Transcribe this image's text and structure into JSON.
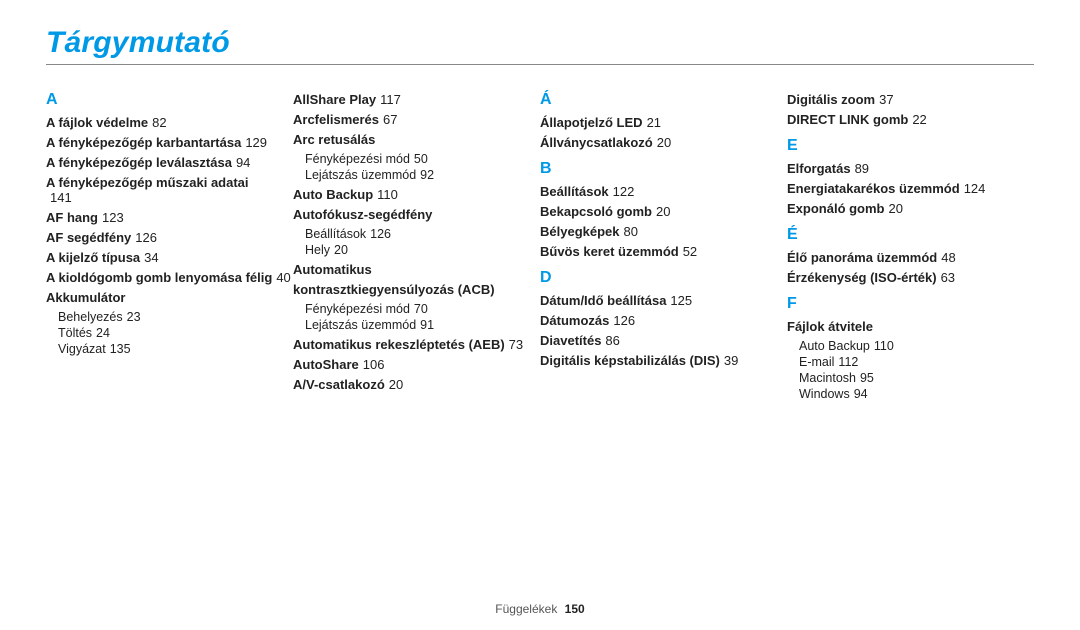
{
  "title": "Tárgymutató",
  "footer": {
    "label": "Függelékek",
    "page": "150"
  },
  "col1": {
    "letter1": "A",
    "e1": {
      "t": "A fájlok védelme",
      "p": "82"
    },
    "e2": {
      "t": "A fényképezőgép karbantartása",
      "p": "129"
    },
    "e3": {
      "t": "A fényképezőgép leválasztása",
      "p": "94"
    },
    "e4": {
      "t": "A fényképezőgép műszaki adatai",
      "p": "141"
    },
    "e5": {
      "t": "AF hang",
      "p": "123"
    },
    "e6": {
      "t": "AF segédfény",
      "p": "126"
    },
    "e7": {
      "t": "A kijelző típusa",
      "p": "34"
    },
    "e8": {
      "t": "A kioldógomb gomb lenyomása félig",
      "p": "40"
    },
    "e9": {
      "t": "Akkumulátor"
    },
    "s91": {
      "t": "Behelyezés",
      "p": "23"
    },
    "s92": {
      "t": "Töltés",
      "p": "24"
    },
    "s93": {
      "t": "Vigyázat",
      "p": "135"
    }
  },
  "col2": {
    "e1": {
      "t": "AllShare Play",
      "p": "117"
    },
    "e2": {
      "t": "Arcfelismerés",
      "p": "67"
    },
    "e3": {
      "t": "Arc retusálás"
    },
    "s31": {
      "t": "Fényképezési mód",
      "p": "50"
    },
    "s32": {
      "t": "Lejátszás üzemmód",
      "p": "92"
    },
    "e4": {
      "t": "Auto Backup",
      "p": "110"
    },
    "e5": {
      "t": "Autofókusz-segédfény"
    },
    "s51": {
      "t": "Beállítások",
      "p": "126"
    },
    "s52": {
      "t": "Hely",
      "p": "20"
    },
    "e6a": {
      "t": "Automatikus"
    },
    "e6b": {
      "t": "kontrasztkiegyensúlyozás (ACB)"
    },
    "s61": {
      "t": "Fényképezési mód",
      "p": "70"
    },
    "s62": {
      "t": "Lejátszás üzemmód",
      "p": "91"
    },
    "e7": {
      "t": "Automatikus rekeszléptetés (AEB)",
      "p": "73"
    },
    "e8": {
      "t": "AutoShare",
      "p": "106"
    },
    "e9": {
      "t": "A/V-csatlakozó",
      "p": "20"
    }
  },
  "col3": {
    "letterA2": "Á",
    "a1": {
      "t": "Állapotjelző LED",
      "p": "21"
    },
    "a2": {
      "t": "Állványcsatlakozó",
      "p": "20"
    },
    "letterB": "B",
    "b1": {
      "t": "Beállítások",
      "p": "122"
    },
    "b2": {
      "t": "Bekapcsoló gomb",
      "p": "20"
    },
    "b3": {
      "t": "Bélyegképek",
      "p": "80"
    },
    "b4": {
      "t": "Bűvös keret üzemmód",
      "p": "52"
    },
    "letterD": "D",
    "d1": {
      "t": "Dátum/Idő beállítása",
      "p": "125"
    },
    "d2": {
      "t": "Dátumozás",
      "p": "126"
    },
    "d3": {
      "t": "Diavetítés",
      "p": "86"
    },
    "d4": {
      "t": "Digitális képstabilizálás (DIS)",
      "p": "39"
    }
  },
  "col4": {
    "d5": {
      "t": "Digitális zoom",
      "p": "37"
    },
    "d6": {
      "t": "DIRECT LINK gomb",
      "p": "22"
    },
    "letterE": "E",
    "e1": {
      "t": "Elforgatás",
      "p": "89"
    },
    "e2": {
      "t": "Energiatakarékos üzemmód",
      "p": "124"
    },
    "e3": {
      "t": "Exponáló gomb",
      "p": "20"
    },
    "letterE2": "É",
    "ee1": {
      "t": "Élő panoráma üzemmód",
      "p": "48"
    },
    "ee2": {
      "t": "Érzékenység (ISO-érték)",
      "p": "63"
    },
    "letterF": "F",
    "f1": {
      "t": "Fájlok átvitele"
    },
    "fs1": {
      "t": "Auto Backup",
      "p": "110"
    },
    "fs2": {
      "t": "E-mail",
      "p": "112"
    },
    "fs3": {
      "t": "Macintosh",
      "p": "95"
    },
    "fs4": {
      "t": "Windows",
      "p": "94"
    }
  }
}
